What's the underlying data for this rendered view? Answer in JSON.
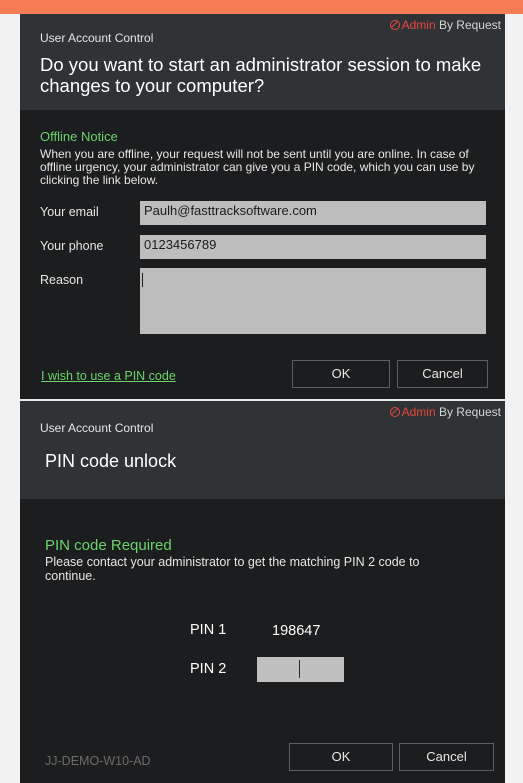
{
  "colors": {
    "accent": "#f57c54",
    "header_bg": "#2f3336",
    "body_bg": "#1c1d1e",
    "notice_green": "#6bd36b",
    "brand_red": "#e8473e",
    "field_bg": "#bdbdbd"
  },
  "brand": {
    "part1": "Admin",
    "part2": " By Request",
    "icon": "no-entry-icon"
  },
  "dialog1": {
    "uac_label": "User Account Control",
    "question": "Do you want to start an administrator session to make changes to your computer?",
    "notice_title": "Offline Notice",
    "notice_text": "When you are offline, your request will not be sent until you are online. In case of offline urgency, your administrator can give you a PIN code, which you can use by clicking the link below.",
    "email_label": "Your email",
    "email_value": "Paulh@fasttracksoftware.com",
    "phone_label": "Your phone",
    "phone_value": "0123456789",
    "reason_label": "Reason",
    "reason_value": "",
    "pin_link": "I wish to use a PIN code",
    "ok": "OK",
    "cancel": "Cancel"
  },
  "dialog2": {
    "uac_label": "User Account Control",
    "title": "PIN code unlock",
    "required_title": "PIN code Required",
    "required_text": "Please contact your administrator to get the matching PIN 2 code to continue.",
    "pin1_label": "PIN 1",
    "pin1_value": "198647",
    "pin2_label": "PIN 2",
    "pin2_value": "",
    "hostname": "JJ-DEMO-W10-AD",
    "ok": "OK",
    "cancel": "Cancel"
  }
}
